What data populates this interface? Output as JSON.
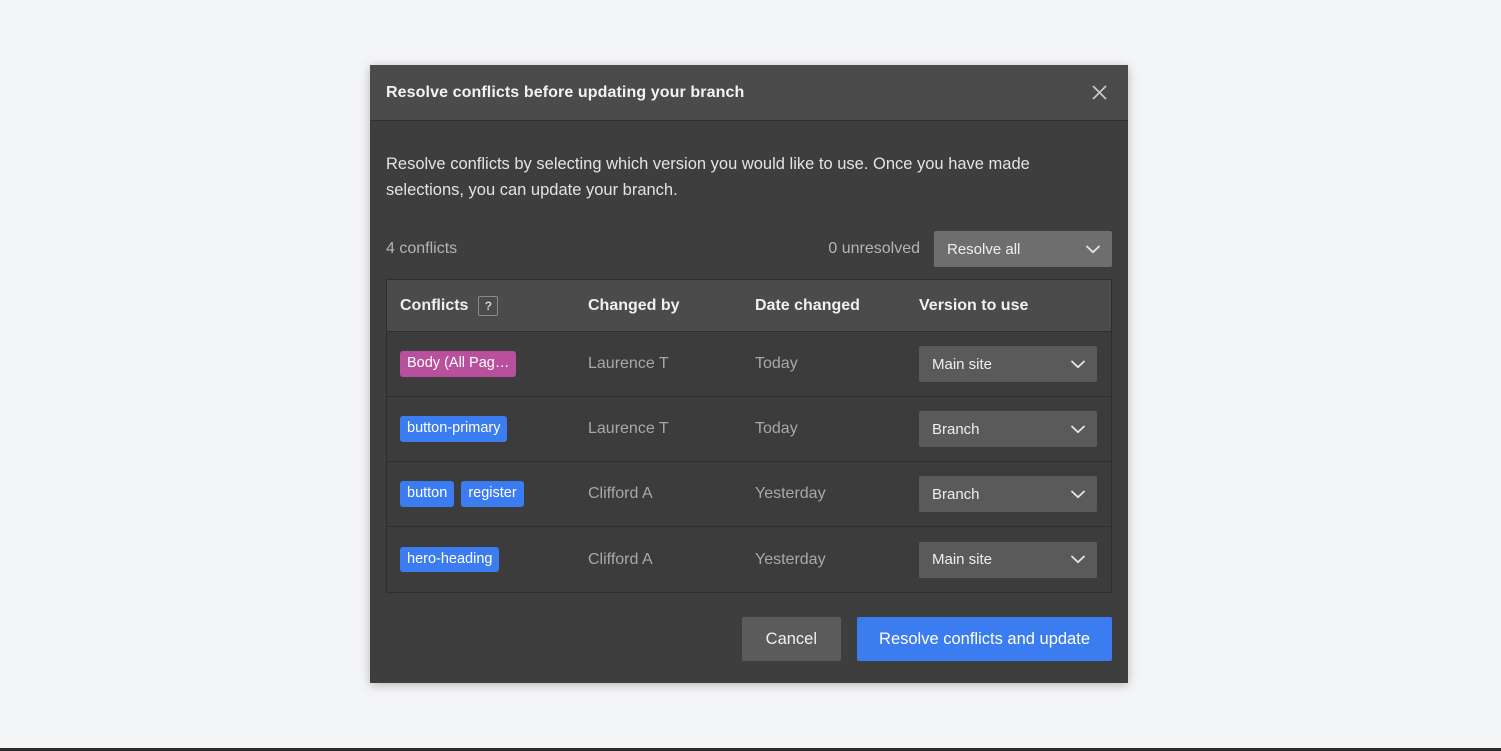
{
  "dialog": {
    "title": "Resolve conflicts before updating your branch",
    "close_icon": "close-icon",
    "intro": "Resolve conflicts by selecting which version you would like to use. Once you have made selections, you can update your branch.",
    "summary": {
      "conflict_count": "4 conflicts",
      "unresolved_count": "0 unresolved",
      "resolve_all": {
        "value": "Resolve all",
        "options": [
          "Resolve all",
          "Main site",
          "Branch"
        ]
      }
    },
    "table": {
      "columns": [
        "Conflicts",
        "Changed by",
        "Date changed",
        "Version to use"
      ],
      "help_icon_label": "?",
      "rows": [
        {
          "badges": [
            {
              "label": "Body (All Pag…",
              "color": "#b9509e"
            }
          ],
          "changed_by": "Laurence T",
          "date_changed": "Today",
          "version": "Main site"
        },
        {
          "badges": [
            {
              "label": "button-primary",
              "color": "#3b7cf0"
            }
          ],
          "changed_by": "Laurence T",
          "date_changed": "Today",
          "version": "Branch"
        },
        {
          "badges": [
            {
              "label": "button",
              "color": "#3b7cf0"
            },
            {
              "label": "register",
              "color": "#3b7cf0"
            }
          ],
          "changed_by": "Clifford A",
          "date_changed": "Yesterday",
          "version": "Branch"
        },
        {
          "badges": [
            {
              "label": "hero-heading",
              "color": "#3b7cf0"
            }
          ],
          "changed_by": "Clifford A",
          "date_changed": "Yesterday",
          "version": "Main site"
        }
      ],
      "version_options": [
        "Main site",
        "Branch"
      ]
    },
    "footer": {
      "cancel_label": "Cancel",
      "primary_label": "Resolve conflicts and update"
    }
  },
  "colors": {
    "page_background": "#f4f5f7",
    "dialog_background": "#3e3e3e",
    "header_background": "#4b4b4b",
    "row_background": "#3c3c3c",
    "accent_blue": "#3b7cf0",
    "accent_magenta": "#b9509e"
  }
}
